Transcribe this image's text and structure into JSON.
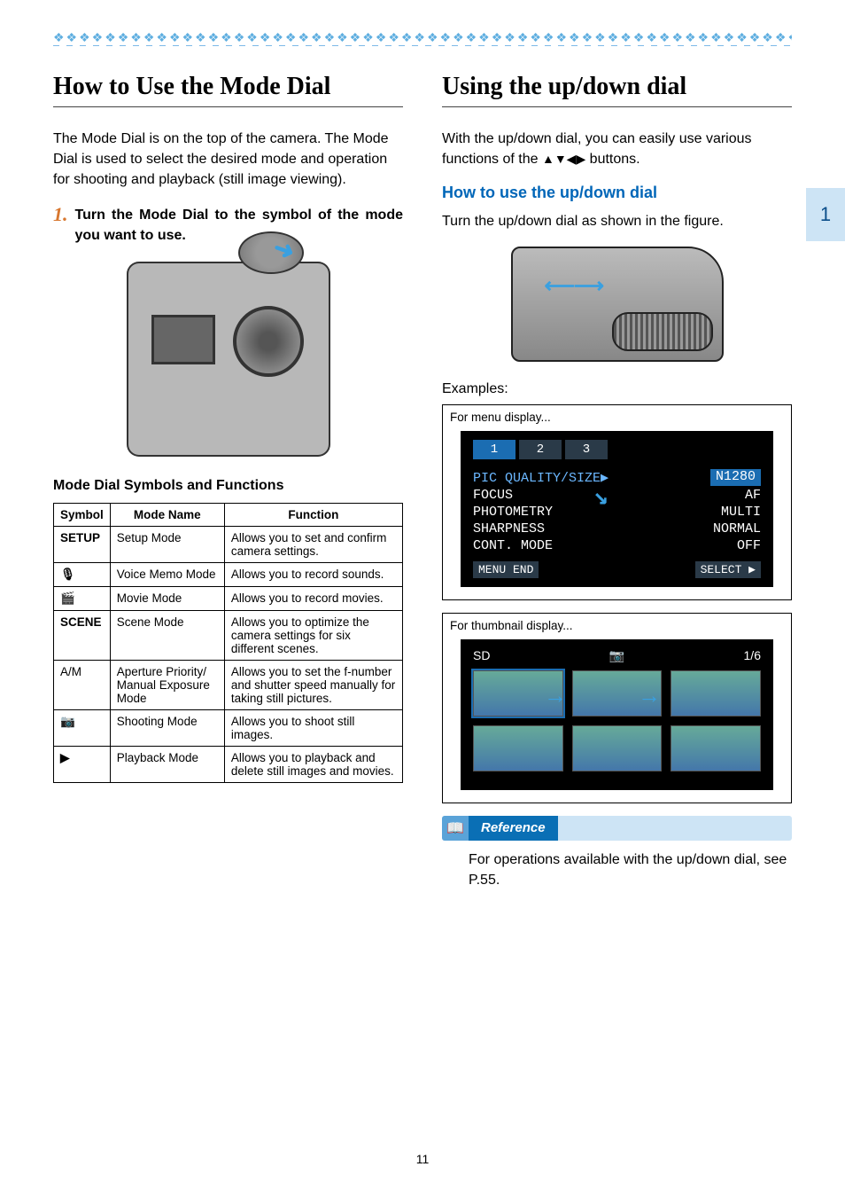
{
  "page_number": "11",
  "section_tab": "1",
  "left": {
    "title": "How to Use the Mode Dial",
    "intro": "The Mode Dial is on the top of the camera. The Mode Dial is used to select the desired mode and operation for shooting and playback (still image viewing).",
    "step_num": "1.",
    "step_text": "Turn the Mode Dial to the symbol of the mode you want to use.",
    "table_heading": "Mode Dial Symbols and Functions",
    "columns": {
      "c1": "Symbol",
      "c2": "Mode Name",
      "c3": "Function"
    },
    "rows": [
      {
        "symbol": "SETUP",
        "name": "Setup Mode",
        "func": "Allows you to set and confirm camera settings."
      },
      {
        "symbol": "🎙",
        "name": "Voice Memo Mode",
        "func": "Allows you to record sounds."
      },
      {
        "symbol": "🎬",
        "name": "Movie Mode",
        "func": "Allows you to record movies."
      },
      {
        "symbol": "SCENE",
        "name": "Scene Mode",
        "func": "Allows you to optimize the camera settings for six different scenes."
      },
      {
        "symbol": "A/M",
        "name": "Aperture Priority/ Manual Exposure Mode",
        "func": "Allows you to set the f-number and shutter speed manually for taking still pictures."
      },
      {
        "symbol": "📷",
        "name": "Shooting Mode",
        "func": "Allows you to shoot still images."
      },
      {
        "symbol": "▶",
        "name": "Playback Mode",
        "func": "Allows you to playback and delete still images and movies."
      }
    ]
  },
  "right": {
    "title": "Using the up/down dial",
    "intro_a": "With the up/down dial, you can easily use various functions of the ",
    "intro_arrows": "▲▼◀▶",
    "intro_b": " buttons.",
    "subhead": "How to use the up/down dial",
    "turn_text": "Turn the up/down dial as shown in the figure.",
    "examples_label": "Examples:",
    "ex1_caption": "For menu display...",
    "ex2_caption": "For thumbnail display...",
    "menu": {
      "tabs": [
        "1",
        "2",
        "3"
      ],
      "rows": [
        {
          "k": "PIC QUALITY/SIZE▶",
          "v": "N1280",
          "hl": true
        },
        {
          "k": "FOCUS",
          "v": "AF"
        },
        {
          "k": "PHOTOMETRY",
          "v": "MULTI"
        },
        {
          "k": "SHARPNESS",
          "v": "NORMAL"
        },
        {
          "k": "CONT. MODE",
          "v": "OFF"
        }
      ],
      "footer_l": "MENU END",
      "footer_r": "SELECT ▶"
    },
    "thumb": {
      "counter": "1/6",
      "sd": "SD"
    },
    "reference_label": "Reference",
    "reference_text": "For operations available with the up/down dial, see P.55."
  }
}
